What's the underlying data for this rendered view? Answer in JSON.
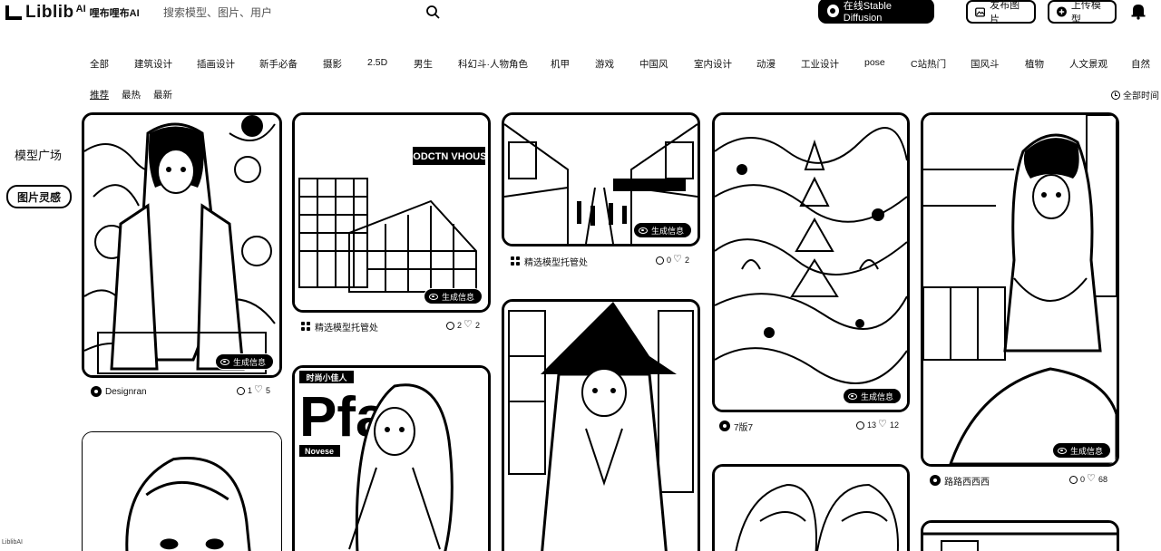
{
  "header": {
    "logo": "Liblib",
    "logo_ai": "AI",
    "logo_cn": "哩布哩布AI",
    "search_placeholder": "搜索模型、图片、用户",
    "sd_button": "在线Stable Diffusion",
    "publish_button": "发布图片",
    "upload_button": "上传模型"
  },
  "categories": [
    "全部",
    "建筑设计",
    "插画设计",
    "新手必备",
    "摄影",
    "2.5D",
    "男生",
    "科幻斗·人物角色",
    "机甲",
    "游戏",
    "中国风",
    "室内设计",
    "动漫",
    "工业设计",
    "pose",
    "C站热门",
    "国风斗",
    "植物",
    "人文景观",
    "自然"
  ],
  "sorts": [
    "推荐",
    "最热",
    "最新"
  ],
  "time_filter": "全部时间",
  "sidebar": {
    "model_plaza": "模型广场",
    "image_gallery": "图片灵感",
    "footer": "LiblibAI"
  },
  "gen_label": "生成信息",
  "cards": [
    {
      "author": "Designran",
      "comments": "1",
      "likes": "5"
    },
    {
      "author": "精选模型托管处",
      "comments": "2",
      "likes": "2"
    },
    {
      "author": "精选模型托管处",
      "comments": "0",
      "likes": "2"
    },
    {
      "author": "7版7",
      "comments": "13",
      "likes": "12"
    },
    {
      "author": "路路西西西",
      "comments": "0",
      "likes": "68"
    }
  ],
  "poster_text": {
    "building_title": "MODCTN VHOUSE",
    "magazine_title": "Pfal",
    "magazine_top": "时尚小佳人",
    "magazine_mid": "Novese"
  },
  "colors": {
    "ink": "#000000",
    "paper": "#ffffff"
  }
}
